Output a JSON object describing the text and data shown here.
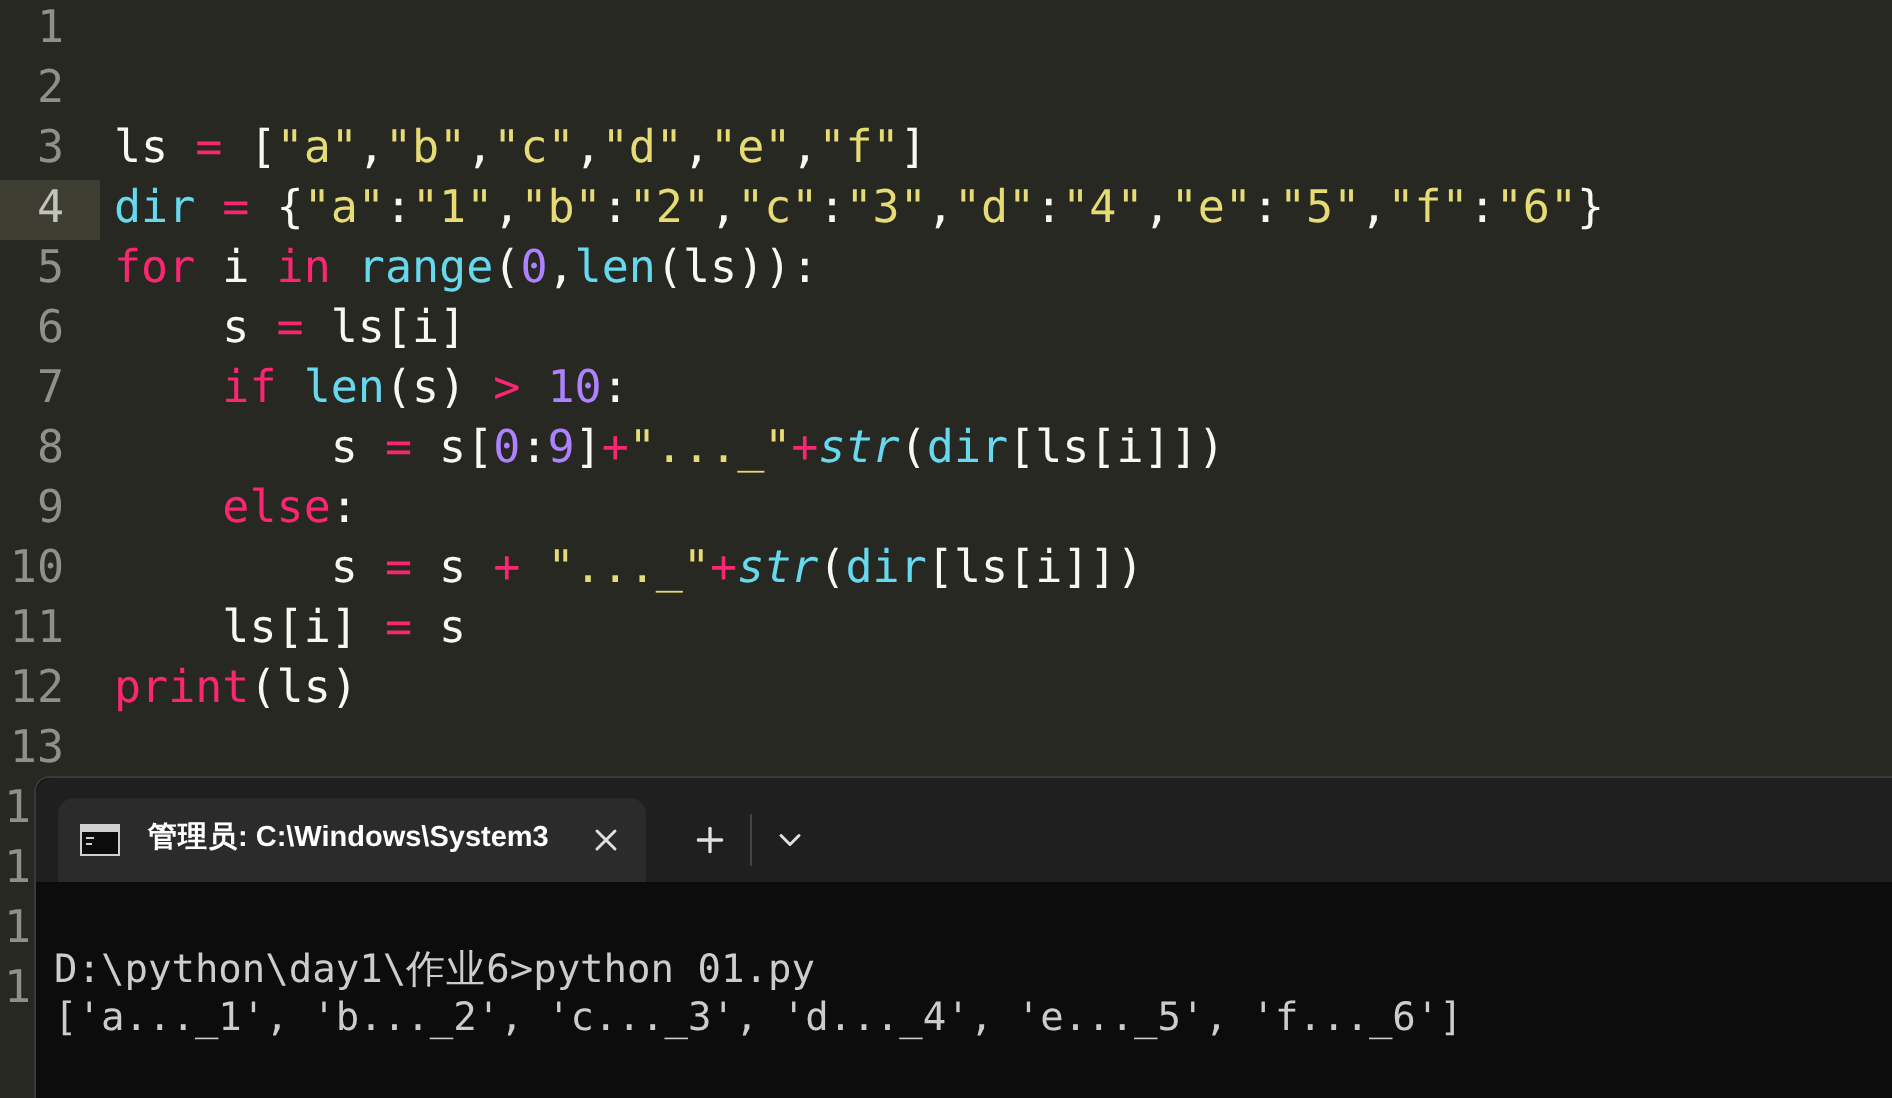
{
  "editor": {
    "lines": [
      {
        "number": "1",
        "current": false,
        "covered": false
      },
      {
        "number": "2",
        "current": false,
        "covered": false
      },
      {
        "number": "3",
        "current": false,
        "covered": false,
        "tokens": [
          {
            "kind": "plain",
            "text": "ls "
          },
          {
            "kind": "operator",
            "text": "="
          },
          {
            "kind": "plain",
            "text": " ["
          },
          {
            "kind": "string",
            "text": "\"a\""
          },
          {
            "kind": "plain",
            "text": ","
          },
          {
            "kind": "string",
            "text": "\"b\""
          },
          {
            "kind": "plain",
            "text": ","
          },
          {
            "kind": "string",
            "text": "\"c\""
          },
          {
            "kind": "plain",
            "text": ","
          },
          {
            "kind": "string",
            "text": "\"d\""
          },
          {
            "kind": "plain",
            "text": ","
          },
          {
            "kind": "string",
            "text": "\"e\""
          },
          {
            "kind": "plain",
            "text": ","
          },
          {
            "kind": "string",
            "text": "\"f\""
          },
          {
            "kind": "plain",
            "text": "]"
          }
        ]
      },
      {
        "number": "4",
        "current": true,
        "covered": false,
        "tokens": [
          {
            "kind": "builtin",
            "text": "dir"
          },
          {
            "kind": "operator",
            "text": " ="
          },
          {
            "kind": "plain",
            "text": " {"
          },
          {
            "kind": "string",
            "text": "\"a\""
          },
          {
            "kind": "plain",
            "text": ":"
          },
          {
            "kind": "string",
            "text": "\"1\""
          },
          {
            "kind": "plain",
            "text": ","
          },
          {
            "kind": "string",
            "text": "\"b\""
          },
          {
            "kind": "plain",
            "text": ":"
          },
          {
            "kind": "string",
            "text": "\"2\""
          },
          {
            "kind": "plain",
            "text": ","
          },
          {
            "kind": "string",
            "text": "\"c\""
          },
          {
            "kind": "plain",
            "text": ":"
          },
          {
            "kind": "string",
            "text": "\"3\""
          },
          {
            "kind": "plain",
            "text": ","
          },
          {
            "kind": "string",
            "text": "\"d\""
          },
          {
            "kind": "plain",
            "text": ":"
          },
          {
            "kind": "string",
            "text": "\"4\""
          },
          {
            "kind": "plain",
            "text": ","
          },
          {
            "kind": "string",
            "text": "\"e\""
          },
          {
            "kind": "plain",
            "text": ":"
          },
          {
            "kind": "string",
            "text": "\"5\""
          },
          {
            "kind": "plain",
            "text": ","
          },
          {
            "kind": "string",
            "text": "\"f\""
          },
          {
            "kind": "plain",
            "text": ":"
          },
          {
            "kind": "string",
            "text": "\"6\""
          },
          {
            "kind": "plain",
            "text": "}"
          }
        ]
      },
      {
        "number": "5",
        "current": false,
        "covered": false,
        "tokens": [
          {
            "kind": "keyword",
            "text": "for"
          },
          {
            "kind": "plain",
            "text": " i "
          },
          {
            "kind": "keyword",
            "text": "in"
          },
          {
            "kind": "builtin",
            "text": " range"
          },
          {
            "kind": "plain",
            "text": "("
          },
          {
            "kind": "number",
            "text": "0"
          },
          {
            "kind": "plain",
            "text": ","
          },
          {
            "kind": "builtin",
            "text": "len"
          },
          {
            "kind": "plain",
            "text": "(ls)):"
          }
        ]
      },
      {
        "number": "6",
        "current": false,
        "covered": false,
        "tokens": [
          {
            "kind": "plain",
            "text": "    s "
          },
          {
            "kind": "operator",
            "text": "="
          },
          {
            "kind": "plain",
            "text": " ls[i]"
          }
        ]
      },
      {
        "number": "7",
        "current": false,
        "covered": false,
        "tokens": [
          {
            "kind": "keyword",
            "text": "    if"
          },
          {
            "kind": "builtin",
            "text": " len"
          },
          {
            "kind": "plain",
            "text": "(s) "
          },
          {
            "kind": "operator",
            "text": ">"
          },
          {
            "kind": "number",
            "text": " 10"
          },
          {
            "kind": "plain",
            "text": ":"
          }
        ]
      },
      {
        "number": "8",
        "current": false,
        "covered": false,
        "tokens": [
          {
            "kind": "plain",
            "text": "        s "
          },
          {
            "kind": "operator",
            "text": "="
          },
          {
            "kind": "plain",
            "text": " s["
          },
          {
            "kind": "number",
            "text": "0"
          },
          {
            "kind": "plain",
            "text": ":"
          },
          {
            "kind": "number",
            "text": "9"
          },
          {
            "kind": "plain",
            "text": "]"
          },
          {
            "kind": "operator",
            "text": "+"
          },
          {
            "kind": "string",
            "text": "\"..._\""
          },
          {
            "kind": "operator",
            "text": "+"
          },
          {
            "kind": "italic",
            "text": "str"
          },
          {
            "kind": "plain",
            "text": "("
          },
          {
            "kind": "builtin",
            "text": "dir"
          },
          {
            "kind": "plain",
            "text": "[ls[i]])"
          }
        ]
      },
      {
        "number": "9",
        "current": false,
        "covered": false,
        "tokens": [
          {
            "kind": "keyword",
            "text": "    else"
          },
          {
            "kind": "plain",
            "text": ":"
          }
        ]
      },
      {
        "number": "10",
        "current": false,
        "covered": false,
        "tokens": [
          {
            "kind": "plain",
            "text": "        s "
          },
          {
            "kind": "operator",
            "text": "="
          },
          {
            "kind": "plain",
            "text": " s "
          },
          {
            "kind": "operator",
            "text": "+"
          },
          {
            "kind": "string",
            "text": " \"..._\""
          },
          {
            "kind": "operator",
            "text": "+"
          },
          {
            "kind": "italic",
            "text": "str"
          },
          {
            "kind": "plain",
            "text": "("
          },
          {
            "kind": "builtin",
            "text": "dir"
          },
          {
            "kind": "plain",
            "text": "[ls[i]])"
          }
        ]
      },
      {
        "number": "11",
        "current": false,
        "covered": false,
        "tokens": [
          {
            "kind": "plain",
            "text": "    ls[i] "
          },
          {
            "kind": "operator",
            "text": "="
          },
          {
            "kind": "plain",
            "text": " s"
          }
        ]
      },
      {
        "number": "12",
        "current": false,
        "covered": false,
        "tokens": [
          {
            "kind": "keyword",
            "text": "print"
          },
          {
            "kind": "plain",
            "text": "(ls)"
          }
        ]
      },
      {
        "number": "13",
        "current": false,
        "covered": false
      },
      {
        "number": "1",
        "current": false,
        "covered": true
      },
      {
        "number": "1",
        "current": false,
        "covered": true
      },
      {
        "number": "1",
        "current": false,
        "covered": true
      },
      {
        "number": "1",
        "current": false,
        "covered": true
      }
    ]
  },
  "terminal": {
    "tab": {
      "title": "管理员: C:\\Windows\\System3",
      "selected": true
    },
    "output": [
      "D:\\python\\day1\\作业6>python 01.py",
      "['a..._1', 'b..._2', 'c..._3', 'd..._4', 'e..._5', 'f..._6']"
    ]
  }
}
